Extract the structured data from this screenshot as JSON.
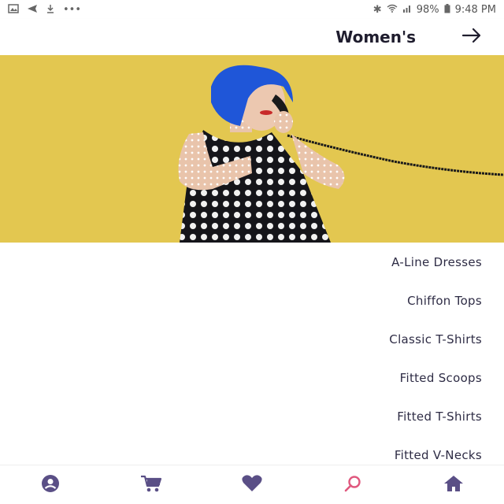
{
  "status_bar": {
    "time": "9:48 PM",
    "battery": "98%"
  },
  "header": {
    "title": "Women's"
  },
  "categories": [
    {
      "label": "A-Line Dresses"
    },
    {
      "label": "Chiffon Tops"
    },
    {
      "label": "Classic T-Shirts"
    },
    {
      "label": "Fitted Scoops"
    },
    {
      "label": "Fitted T-Shirts"
    },
    {
      "label": "Fitted V-Necks"
    }
  ],
  "bottom_nav": {
    "items": [
      {
        "icon": "account-icon"
      },
      {
        "icon": "cart-icon"
      },
      {
        "icon": "heart-icon"
      },
      {
        "icon": "search-icon"
      },
      {
        "icon": "home-icon"
      }
    ]
  },
  "colors": {
    "hero_background": "#e3c750",
    "nav_icon": "#5a4f86",
    "search_icon": "#e0587e",
    "text": "#2e2c45"
  }
}
